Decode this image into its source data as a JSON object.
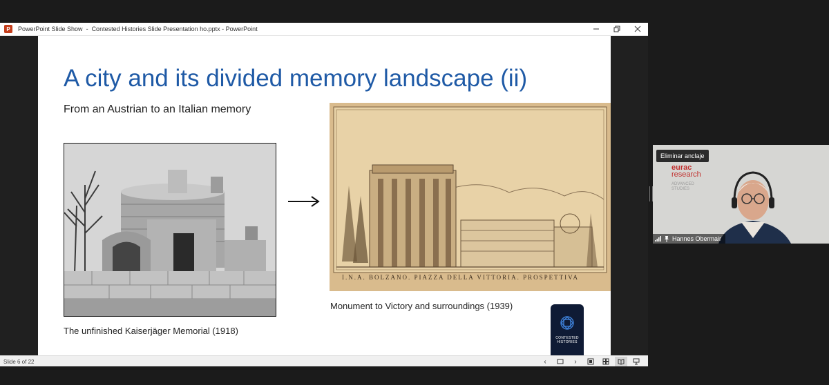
{
  "window": {
    "app_label": "PowerPoint Slide Show",
    "separator": "-",
    "document_title": "Contested Histories Slide Presentation ho.pptx - PowerPoint"
  },
  "slide": {
    "title": "A city and its divided memory landscape (ii)",
    "subtitle": "From an Austrian to an Italian memory",
    "caption_left": "The unfinished Kaiserjäger Memorial (1918)",
    "caption_right": "Monument to Victory and surroundings (1939)",
    "drawing_inscription": "I.N.A. BOLZANO. PIAZZA DELLA VITTORIA. PROSPETTIVA",
    "badge_text_line1": "CONTESTED",
    "badge_text_line2": "HISTORIES"
  },
  "status": {
    "slide_counter": "Slide 6 of 22"
  },
  "video": {
    "unpin_label": "Eliminar anclaje",
    "participant_name": "Hannes Obermair",
    "logo_main_1": "eurac",
    "logo_main_2": "research",
    "logo_sub_1": "ADVANCED",
    "logo_sub_2": "STUDIES"
  },
  "colors": {
    "title_blue": "#1f5aa6",
    "eurac_red": "#c1302e",
    "badge_navy": "#0f1b35"
  }
}
